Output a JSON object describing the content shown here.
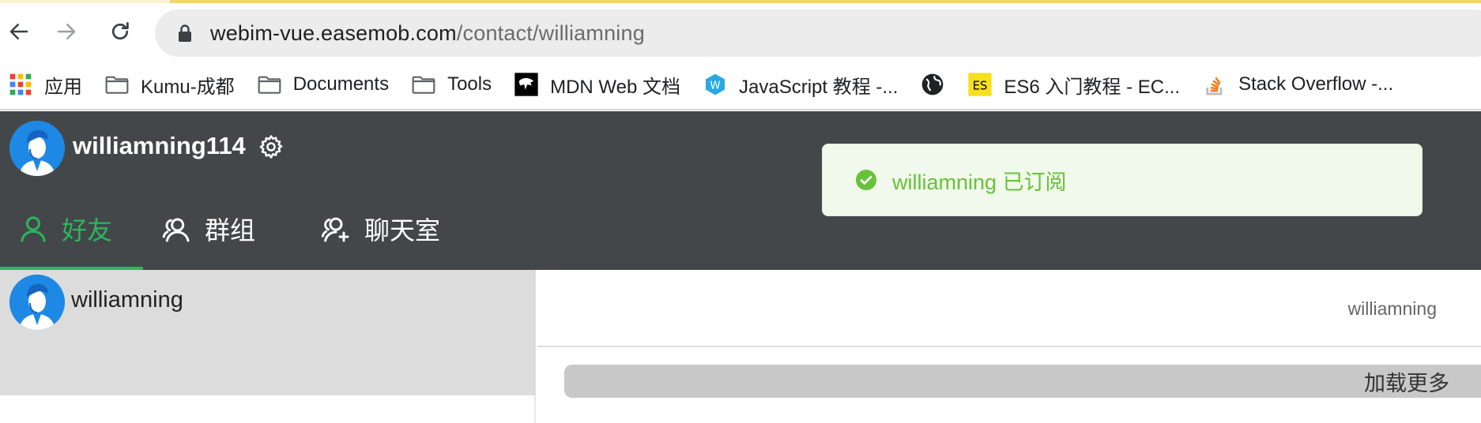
{
  "browser": {
    "url_host": "webim-vue.easemob.com",
    "url_path": "/contact/williamning",
    "bookmarks": [
      {
        "label": "应用",
        "icon": "apps-grid-icon"
      },
      {
        "label": "Kumu-成都",
        "icon": "folder-icon"
      },
      {
        "label": "Documents",
        "icon": "folder-icon"
      },
      {
        "label": "Tools",
        "icon": "folder-icon"
      },
      {
        "label": "MDN Web 文档",
        "icon": "mdn-dino-icon"
      },
      {
        "label": "JavaScript 教程 -...",
        "icon": "w-logo-icon"
      },
      {
        "label": "",
        "icon": "globe-icon"
      },
      {
        "label": "ES6 入门教程 - EC...",
        "icon": "es-badge-icon"
      },
      {
        "label": "Stack Overflow -...",
        "icon": "stackoverflow-icon"
      }
    ]
  },
  "header": {
    "username": "williamning114",
    "tabs": [
      {
        "label": "好友",
        "icon": "user-icon",
        "active": true
      },
      {
        "label": "群组",
        "icon": "group-icon",
        "active": false
      },
      {
        "label": "聊天室",
        "icon": "chatroom-icon",
        "active": false
      }
    ]
  },
  "toast": {
    "message": "williamning 已订阅",
    "type": "success"
  },
  "contacts": [
    {
      "name": "williamning",
      "selected": true
    }
  ],
  "chat": {
    "title": "williamning",
    "load_more_label": "加载更多"
  },
  "colors": {
    "header_bg": "#43474a",
    "accent": "#2db55d",
    "toast_text": "#67c23a",
    "toast_bg": "#f0f9eb",
    "avatar_bg": "#1e88e5"
  }
}
